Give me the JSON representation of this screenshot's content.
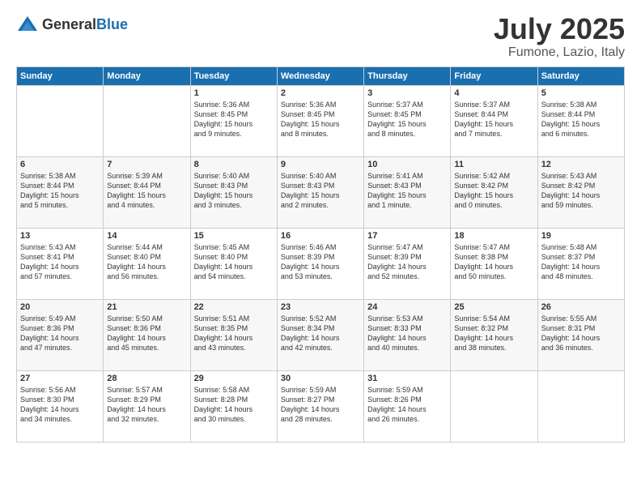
{
  "logo": {
    "text_general": "General",
    "text_blue": "Blue"
  },
  "header": {
    "month": "July 2025",
    "location": "Fumone, Lazio, Italy"
  },
  "weekdays": [
    "Sunday",
    "Monday",
    "Tuesday",
    "Wednesday",
    "Thursday",
    "Friday",
    "Saturday"
  ],
  "weeks": [
    [
      {
        "day": "",
        "info": ""
      },
      {
        "day": "",
        "info": ""
      },
      {
        "day": "1",
        "info": "Sunrise: 5:36 AM\nSunset: 8:45 PM\nDaylight: 15 hours\nand 9 minutes."
      },
      {
        "day": "2",
        "info": "Sunrise: 5:36 AM\nSunset: 8:45 PM\nDaylight: 15 hours\nand 8 minutes."
      },
      {
        "day": "3",
        "info": "Sunrise: 5:37 AM\nSunset: 8:45 PM\nDaylight: 15 hours\nand 8 minutes."
      },
      {
        "day": "4",
        "info": "Sunrise: 5:37 AM\nSunset: 8:44 PM\nDaylight: 15 hours\nand 7 minutes."
      },
      {
        "day": "5",
        "info": "Sunrise: 5:38 AM\nSunset: 8:44 PM\nDaylight: 15 hours\nand 6 minutes."
      }
    ],
    [
      {
        "day": "6",
        "info": "Sunrise: 5:38 AM\nSunset: 8:44 PM\nDaylight: 15 hours\nand 5 minutes."
      },
      {
        "day": "7",
        "info": "Sunrise: 5:39 AM\nSunset: 8:44 PM\nDaylight: 15 hours\nand 4 minutes."
      },
      {
        "day": "8",
        "info": "Sunrise: 5:40 AM\nSunset: 8:43 PM\nDaylight: 15 hours\nand 3 minutes."
      },
      {
        "day": "9",
        "info": "Sunrise: 5:40 AM\nSunset: 8:43 PM\nDaylight: 15 hours\nand 2 minutes."
      },
      {
        "day": "10",
        "info": "Sunrise: 5:41 AM\nSunset: 8:43 PM\nDaylight: 15 hours\nand 1 minute."
      },
      {
        "day": "11",
        "info": "Sunrise: 5:42 AM\nSunset: 8:42 PM\nDaylight: 15 hours\nand 0 minutes."
      },
      {
        "day": "12",
        "info": "Sunrise: 5:43 AM\nSunset: 8:42 PM\nDaylight: 14 hours\nand 59 minutes."
      }
    ],
    [
      {
        "day": "13",
        "info": "Sunrise: 5:43 AM\nSunset: 8:41 PM\nDaylight: 14 hours\nand 57 minutes."
      },
      {
        "day": "14",
        "info": "Sunrise: 5:44 AM\nSunset: 8:40 PM\nDaylight: 14 hours\nand 56 minutes."
      },
      {
        "day": "15",
        "info": "Sunrise: 5:45 AM\nSunset: 8:40 PM\nDaylight: 14 hours\nand 54 minutes."
      },
      {
        "day": "16",
        "info": "Sunrise: 5:46 AM\nSunset: 8:39 PM\nDaylight: 14 hours\nand 53 minutes."
      },
      {
        "day": "17",
        "info": "Sunrise: 5:47 AM\nSunset: 8:39 PM\nDaylight: 14 hours\nand 52 minutes."
      },
      {
        "day": "18",
        "info": "Sunrise: 5:47 AM\nSunset: 8:38 PM\nDaylight: 14 hours\nand 50 minutes."
      },
      {
        "day": "19",
        "info": "Sunrise: 5:48 AM\nSunset: 8:37 PM\nDaylight: 14 hours\nand 48 minutes."
      }
    ],
    [
      {
        "day": "20",
        "info": "Sunrise: 5:49 AM\nSunset: 8:36 PM\nDaylight: 14 hours\nand 47 minutes."
      },
      {
        "day": "21",
        "info": "Sunrise: 5:50 AM\nSunset: 8:36 PM\nDaylight: 14 hours\nand 45 minutes."
      },
      {
        "day": "22",
        "info": "Sunrise: 5:51 AM\nSunset: 8:35 PM\nDaylight: 14 hours\nand 43 minutes."
      },
      {
        "day": "23",
        "info": "Sunrise: 5:52 AM\nSunset: 8:34 PM\nDaylight: 14 hours\nand 42 minutes."
      },
      {
        "day": "24",
        "info": "Sunrise: 5:53 AM\nSunset: 8:33 PM\nDaylight: 14 hours\nand 40 minutes."
      },
      {
        "day": "25",
        "info": "Sunrise: 5:54 AM\nSunset: 8:32 PM\nDaylight: 14 hours\nand 38 minutes."
      },
      {
        "day": "26",
        "info": "Sunrise: 5:55 AM\nSunset: 8:31 PM\nDaylight: 14 hours\nand 36 minutes."
      }
    ],
    [
      {
        "day": "27",
        "info": "Sunrise: 5:56 AM\nSunset: 8:30 PM\nDaylight: 14 hours\nand 34 minutes."
      },
      {
        "day": "28",
        "info": "Sunrise: 5:57 AM\nSunset: 8:29 PM\nDaylight: 14 hours\nand 32 minutes."
      },
      {
        "day": "29",
        "info": "Sunrise: 5:58 AM\nSunset: 8:28 PM\nDaylight: 14 hours\nand 30 minutes."
      },
      {
        "day": "30",
        "info": "Sunrise: 5:59 AM\nSunset: 8:27 PM\nDaylight: 14 hours\nand 28 minutes."
      },
      {
        "day": "31",
        "info": "Sunrise: 5:59 AM\nSunset: 8:26 PM\nDaylight: 14 hours\nand 26 minutes."
      },
      {
        "day": "",
        "info": ""
      },
      {
        "day": "",
        "info": ""
      }
    ]
  ]
}
